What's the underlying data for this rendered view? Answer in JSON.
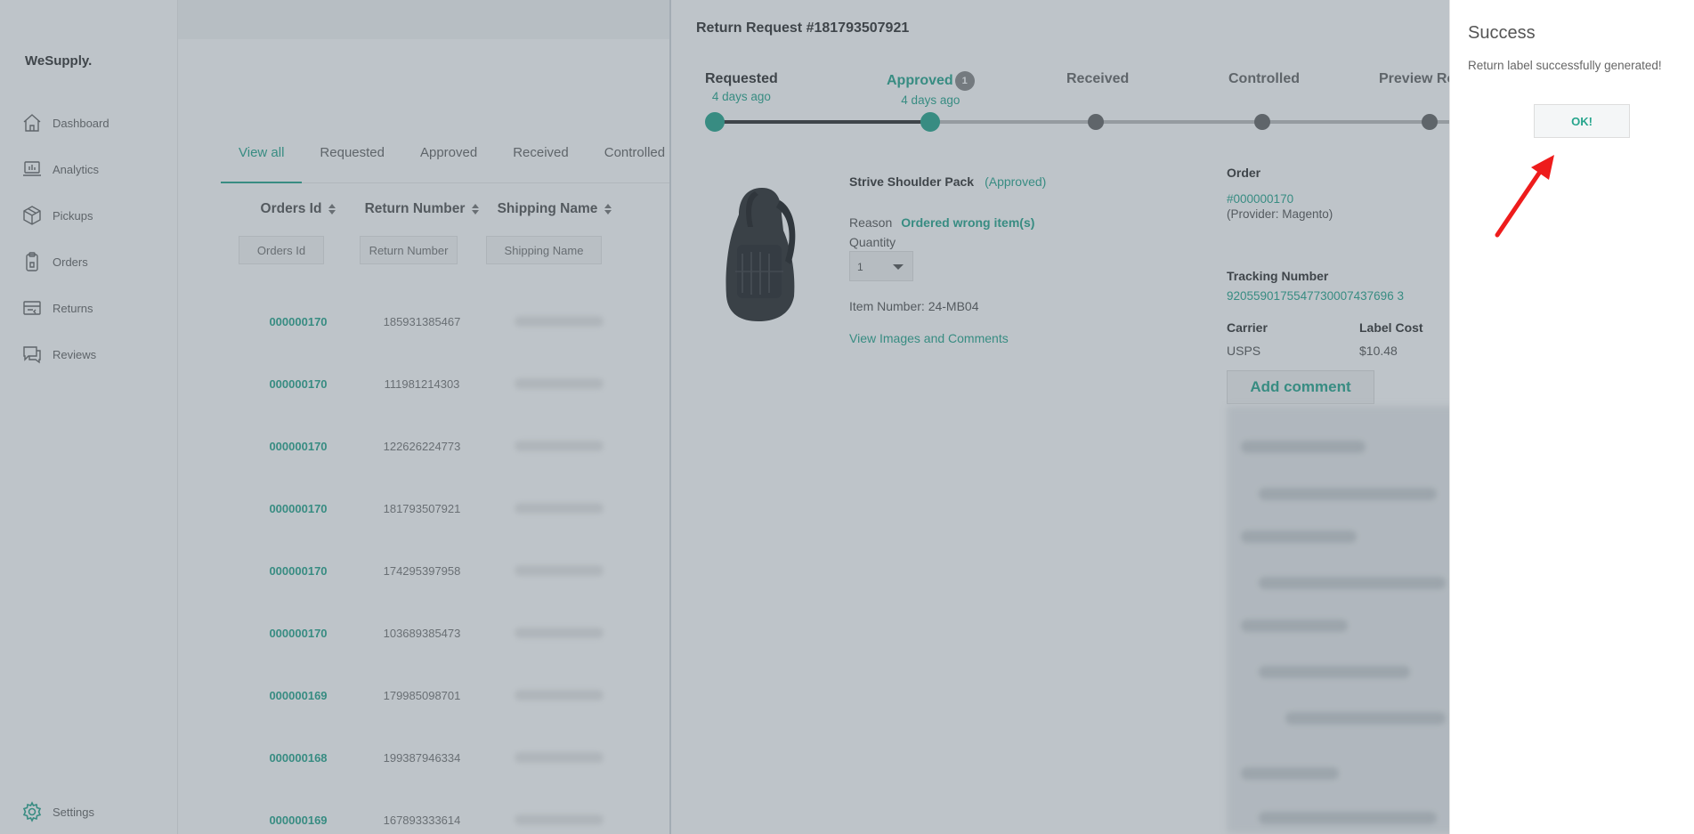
{
  "app": {
    "logo": "WeSupply."
  },
  "sidebar": {
    "items": [
      {
        "label": "Dashboard",
        "icon": "home-icon"
      },
      {
        "label": "Analytics",
        "icon": "analytics-icon"
      },
      {
        "label": "Pickups",
        "icon": "box-icon"
      },
      {
        "label": "Orders",
        "icon": "clipboard-icon"
      },
      {
        "label": "Returns",
        "icon": "returns-icon"
      },
      {
        "label": "Reviews",
        "icon": "chat-icon"
      }
    ],
    "settings": {
      "label": "Settings",
      "icon": "gear-icon"
    }
  },
  "list": {
    "tabs": [
      "View all",
      "Requested",
      "Approved",
      "Received",
      "Controlled"
    ],
    "active_tab": "View all",
    "columns": [
      "Orders Id",
      "Return Number",
      "Shipping Name"
    ],
    "filters": {
      "orders_id": "Orders Id",
      "return_number": "Return Number",
      "shipping_name": "Shipping Name"
    },
    "rows": [
      {
        "order_id": "000000170",
        "return_number": "185931385467"
      },
      {
        "order_id": "000000170",
        "return_number": "111981214303"
      },
      {
        "order_id": "000000170",
        "return_number": "122626224773"
      },
      {
        "order_id": "000000170",
        "return_number": "181793507921"
      },
      {
        "order_id": "000000170",
        "return_number": "174295397958"
      },
      {
        "order_id": "000000170",
        "return_number": "103689385473"
      },
      {
        "order_id": "000000169",
        "return_number": "179985098701"
      },
      {
        "order_id": "000000168",
        "return_number": "199387946334"
      },
      {
        "order_id": "000000169",
        "return_number": "167893333614"
      }
    ]
  },
  "return_request": {
    "title": "Return Request #181793507921",
    "steps": [
      {
        "label": "Requested",
        "time": "4 days ago",
        "state": "done"
      },
      {
        "label": "Approved",
        "time": "4 days ago",
        "state": "current",
        "badge": "1"
      },
      {
        "label": "Received",
        "time": "",
        "state": "pending"
      },
      {
        "label": "Controlled",
        "time": "",
        "state": "pending"
      },
      {
        "label": "Preview Re",
        "time": "",
        "state": "pending"
      }
    ],
    "product": {
      "name": "Strive Shoulder Pack",
      "status": "(Approved)",
      "reason_label": "Reason",
      "reason": "Ordered wrong item(s)",
      "quantity_label": "Quantity",
      "quantity": "1",
      "item_number": "Item Number: 24-MB04",
      "view_images": "View Images and Comments"
    },
    "order": {
      "label": "Order",
      "link": "#000000170",
      "provider": "(Provider: Magento)",
      "tracking_label": "Tracking Number",
      "tracking_number": "9205590175547730007437696 3",
      "carrier_label": "Carrier",
      "carrier": "USPS",
      "label_cost_label": "Label Cost",
      "label_cost": "$10.48",
      "add_comment": "Add comment"
    }
  },
  "success": {
    "title": "Success",
    "message": "Return label successfully generated!",
    "ok": "OK!"
  },
  "colors": {
    "accent": "#27a58d",
    "annotation_arrow": "#ee1c1c"
  }
}
